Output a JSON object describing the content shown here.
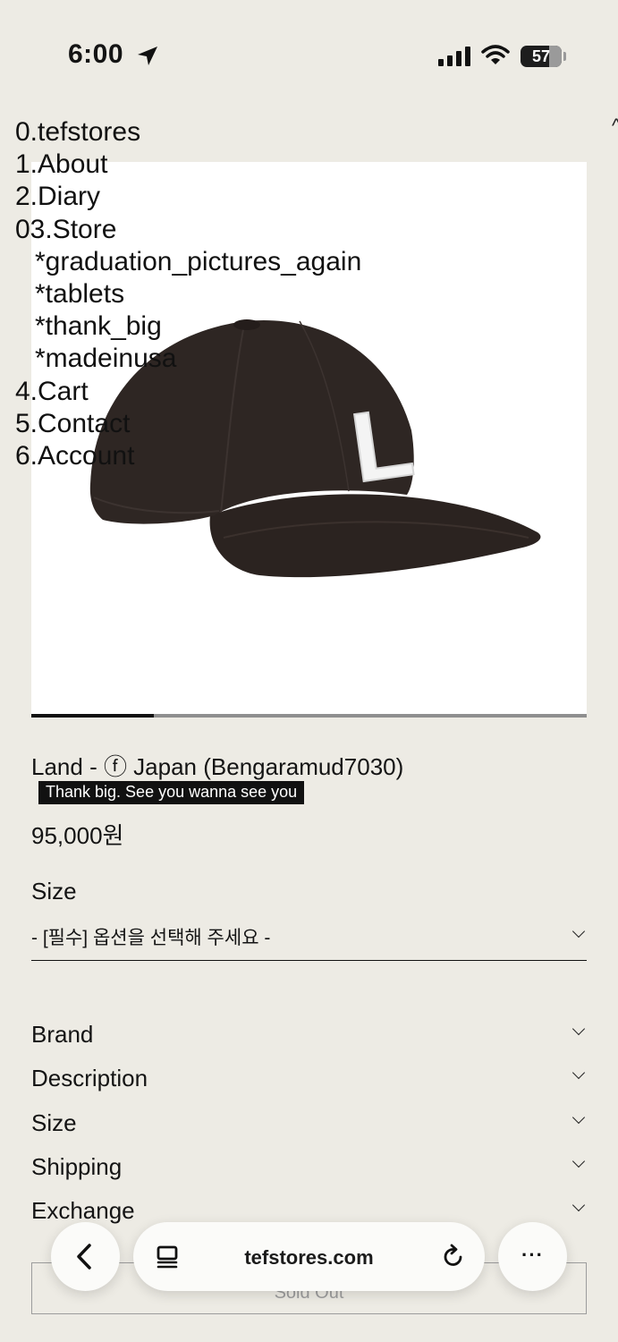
{
  "status_bar": {
    "time": "6:00",
    "battery": "57"
  },
  "menu": {
    "items": [
      "0.tefstores",
      "1.About",
      "2.Diary",
      "03.Store"
    ],
    "store_sub": [
      "*graduation_pictures_again",
      "*tablets",
      "*thank_big",
      "*madeinusa"
    ],
    "items_after": [
      "4.Cart",
      "5.Contact",
      "6.Account"
    ]
  },
  "product": {
    "title": "Land - ⓕ Japan (Bengaramud7030)",
    "tag": "Thank big. See you wanna see you",
    "price": "95,000원",
    "cap_letter": "L",
    "image_progress": 0.22
  },
  "size": {
    "label": "Size",
    "placeholder": "- [필수] 옵션을 선택해 주세요 -"
  },
  "accordions": [
    "Brand",
    "Description",
    "Size",
    "Shipping",
    "Exchange"
  ],
  "sold_out": "Sold Out",
  "browser": {
    "url": "tefstores.com",
    "more": "···"
  }
}
